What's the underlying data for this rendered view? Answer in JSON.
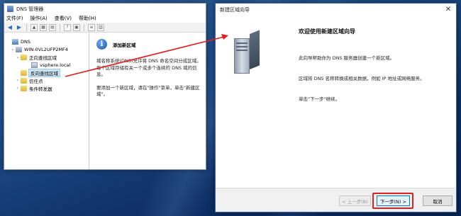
{
  "dns_manager": {
    "title": "DNS 管理器",
    "menu": [
      "文件(F)",
      "操作(A)",
      "查看(V)",
      "帮助(H)"
    ],
    "tree": [
      {
        "label": "DNS",
        "level": 0,
        "icon": "dns-icon"
      },
      {
        "label": "WIN-0VL2UFP2MF4",
        "level": 1,
        "icon": "server-icon",
        "expanded": true
      },
      {
        "label": "正向查找区域",
        "level": 2,
        "icon": "folder-icon",
        "expanded": true
      },
      {
        "label": "vsphere.local",
        "level": 3,
        "icon": "zone-icon"
      },
      {
        "label": "反向查找区域",
        "level": 2,
        "icon": "folder-icon",
        "selected": true
      },
      {
        "label": "信任点",
        "level": 2,
        "icon": "folder-icon"
      },
      {
        "label": "条件转发器",
        "level": 2,
        "icon": "folder-icon"
      }
    ],
    "detail": {
      "heading": "添加新区域",
      "para1": "域名称系统(DNS)允许将 DNS 命名空间分成区域。每个区域存储有关一个或多个连续的 DNS 域的信息。",
      "para2": "要添加一个新区域，请在\"操作\"菜单，单击\"新建区域\"。"
    }
  },
  "wizard": {
    "title": "新建区域向导",
    "heading": "欢迎使用新建区域向导",
    "para1": "此向导帮助你为 DNS 服务器创建一个新区域。",
    "para2": "区域将 DNS 名称转换成相关数据，例如 IP 地址或网络服务。",
    "para3": "单击\"下一步\"继续。",
    "buttons": {
      "back": "< 上一步(B)",
      "next": "下一步(N) >",
      "cancel": "取消"
    },
    "close_glyph": "✕"
  },
  "colors": {
    "highlight_red": "#e02020",
    "desktop_blue": "#1f4c86",
    "selection": "#cce4f7"
  }
}
